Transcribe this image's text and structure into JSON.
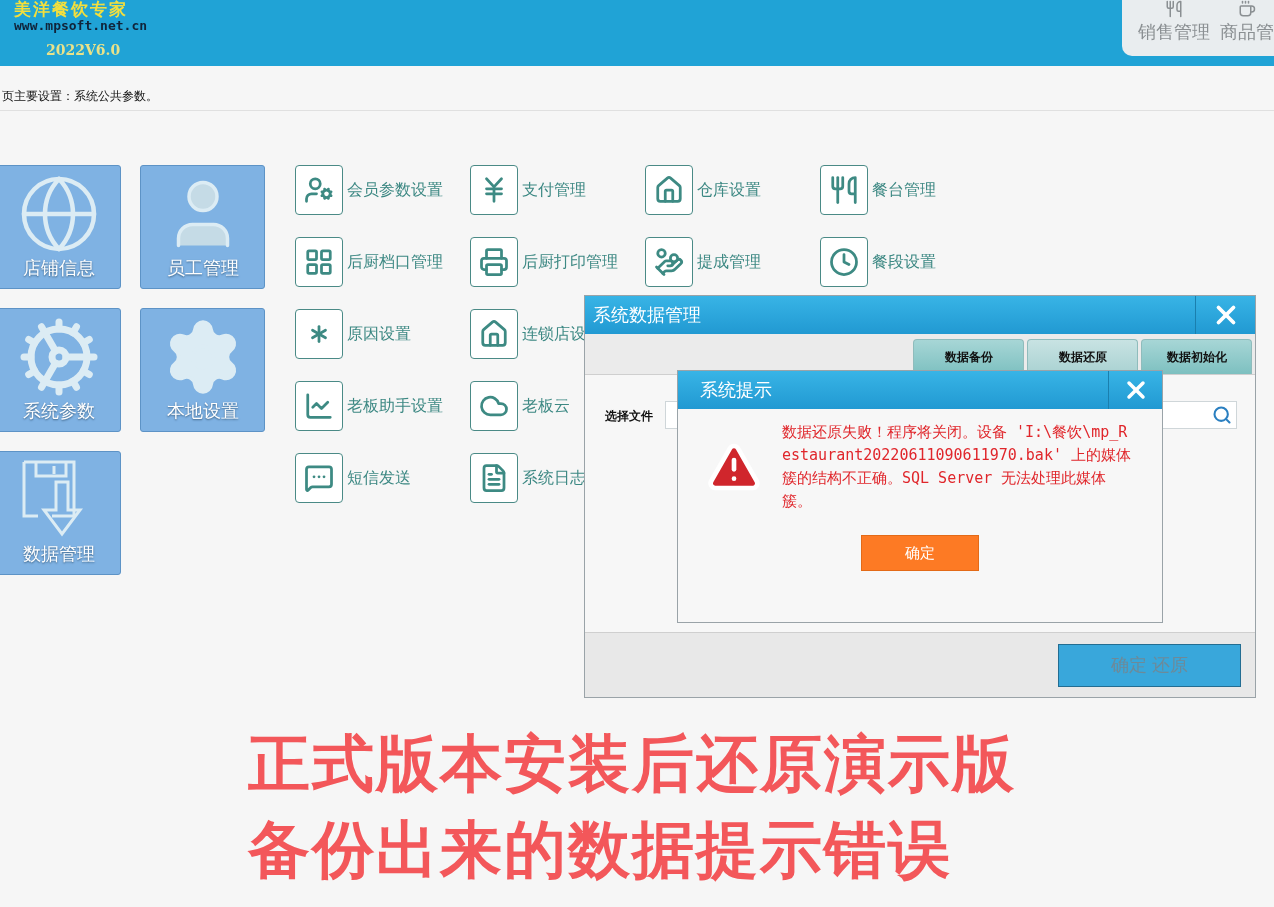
{
  "header": {
    "logo_title": "美洋餐饮专家",
    "logo_url": "www.mpsoft.net.cn",
    "version": "2022V6.0",
    "nav": [
      {
        "label": "销售管理",
        "selected": false
      },
      {
        "label": "商品管",
        "selected": false
      }
    ]
  },
  "breadcrumb": "页主要设置：系统公共参数。",
  "tiles": [
    {
      "label": "店铺信息"
    },
    {
      "label": "员工管理"
    },
    {
      "label": "系统参数"
    },
    {
      "label": "本地设置"
    },
    {
      "label": "数据管理"
    }
  ],
  "shortcut_rows": [
    [
      "会员参数设置",
      "支付管理",
      "仓库设置",
      "餐台管理"
    ],
    [
      "后厨档口管理",
      "后厨打印管理",
      "提成管理",
      "餐段设置"
    ],
    [
      "原因设置",
      "连锁店设"
    ],
    [
      "老板助手设置",
      "老板云"
    ],
    [
      "短信发送",
      "系统日志"
    ]
  ],
  "data_dialog": {
    "title": "系统数据管理",
    "tabs": [
      {
        "label": "数据备份",
        "selected": false
      },
      {
        "label": "数据还原",
        "selected": true
      },
      {
        "label": "数据初始化",
        "selected": false
      }
    ],
    "file_label": "选择文件",
    "confirm_button": {
      "label": "确定 还原",
      "disabled": true
    }
  },
  "alert": {
    "title": "系统提示",
    "message": "数据还原失败！程序将关闭。设备 'I:\\餐饮\\mp_Restaurant20220611090611970.bak' 上的媒体簇的结构不正确。SQL Server 无法处理此媒体簇。",
    "ok": "确定"
  },
  "caption": [
    "正式版本安装后还原演示版",
    "备份出来的数据提示错误"
  ]
}
